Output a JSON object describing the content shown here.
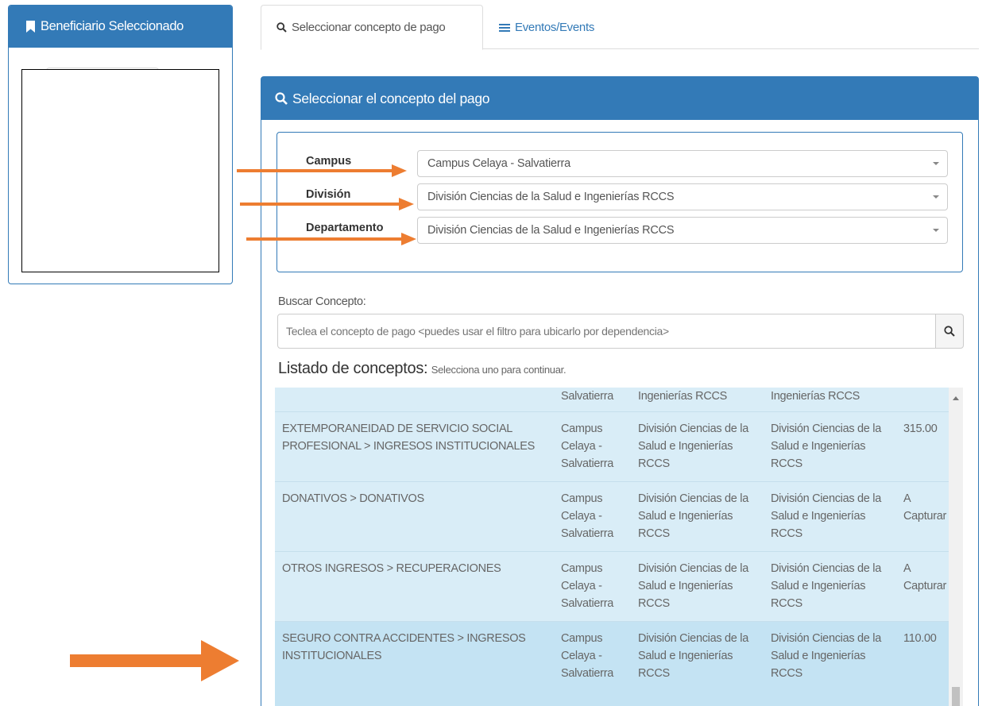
{
  "sidebar": {
    "title": "Beneficiario Seleccionado"
  },
  "tabs": [
    {
      "label": "Seleccionar concepto de pago"
    },
    {
      "label": "Eventos/Events"
    }
  ],
  "panel": {
    "title": "Seleccionar el concepto del pago"
  },
  "filters": {
    "campus": {
      "label": "Campus",
      "value": "Campus Celaya - Salvatierra"
    },
    "division": {
      "label": "División",
      "value": "División Ciencias de la Salud e Ingenierías RCCS"
    },
    "departamento": {
      "label": "Departamento",
      "value": "División Ciencias de la Salud e Ingenierías RCCS"
    }
  },
  "search": {
    "label": "Buscar Concepto:",
    "placeholder": "Teclea el concepto de pago <puedes usar el filtro para ubicarlo por dependencia>"
  },
  "list": {
    "title": "Listado de conceptos:",
    "hint": "Selecciona uno para continuar.",
    "rows": [
      {
        "concept": "",
        "campus": "Salvatierra",
        "division": "Ingenierías RCCS",
        "departamento": "Ingenierías RCCS",
        "amount": ""
      },
      {
        "concept": "EXTEMPORANEIDAD DE SERVICIO SOCIAL PROFESIONAL > INGRESOS INSTITUCIONALES",
        "campus": "Campus Celaya - Salvatierra",
        "division": "División Ciencias de la Salud e Ingenierías RCCS",
        "departamento": "División Ciencias de la Salud e Ingenierías RCCS",
        "amount": "315.00"
      },
      {
        "concept": "DONATIVOS > DONATIVOS",
        "campus": "Campus Celaya - Salvatierra",
        "division": "División Ciencias de la Salud e Ingenierías RCCS",
        "departamento": "División Ciencias de la Salud e Ingenierías RCCS",
        "amount": "A Capturar"
      },
      {
        "concept": "OTROS INGRESOS > RECUPERACIONES",
        "campus": "Campus Celaya - Salvatierra",
        "division": "División Ciencias de la Salud e Ingenierías RCCS",
        "departamento": "División Ciencias de la Salud e Ingenierías RCCS",
        "amount": "A Capturar"
      },
      {
        "concept": "SEGURO CONTRA ACCIDENTES > INGRESOS INSTITUCIONALES",
        "campus": "Campus Celaya - Salvatierra",
        "division": "División Ciencias de la Salud e Ingenierías RCCS",
        "departamento": "División Ciencias de la Salud e Ingenierías RCCS",
        "amount": "110.00"
      }
    ]
  },
  "colors": {
    "primary": "#337ab7",
    "row_bg": "#d9edf7",
    "row_selected": "#c4e3f3",
    "annotation_arrow": "#ed7d31"
  },
  "icons": [
    "bookmark-icon",
    "search-icon",
    "list-icon",
    "caret-down-icon",
    "scroll-up-icon",
    "annotation-arrow"
  ]
}
